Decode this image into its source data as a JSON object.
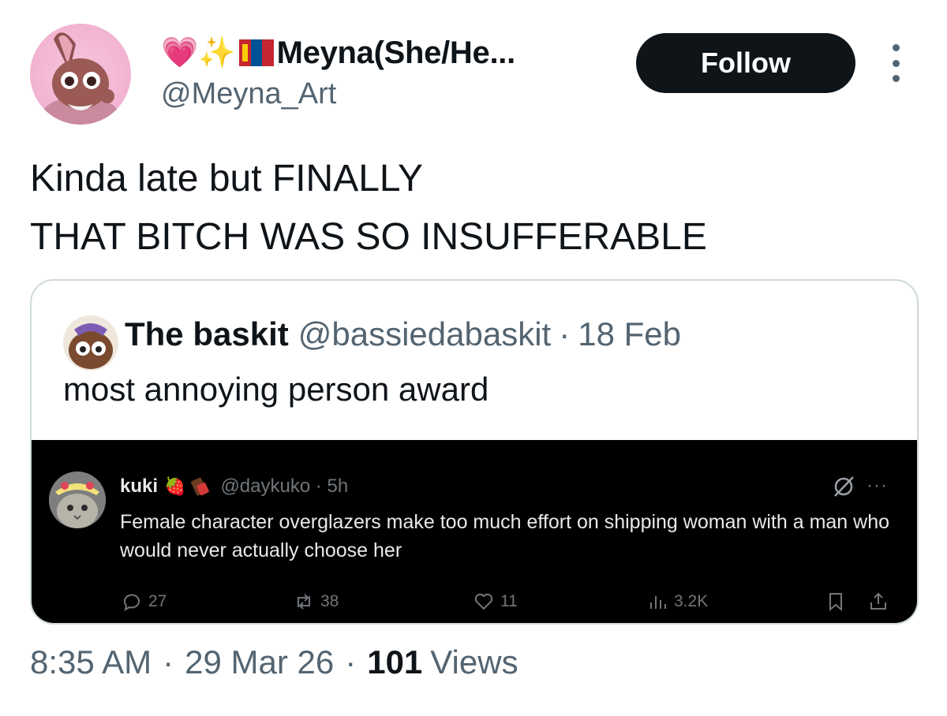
{
  "author": {
    "display_name_emoji": "💗✨",
    "display_name": "Meyna(She/He...",
    "handle": "@Meyna_Art"
  },
  "follow_label": "Follow",
  "tweet": {
    "line1": "Kinda late but FINALLY",
    "line2": "THAT BITCH WAS SO INSUFFERABLE"
  },
  "quote": {
    "name": "The baskit",
    "handle": "@bassiedabaskit",
    "dot": "·",
    "date": "18 Feb",
    "text": "most annoying person award"
  },
  "embedded": {
    "name": "kuki",
    "name_emoji": "🍓",
    "handle": "@daykuko · 5h",
    "text": "Female character overglazers make too much effort on shipping woman with a man who would never actually choose her",
    "more": "···",
    "replies": "27",
    "reposts": "38",
    "likes": "11",
    "views": "3.2K"
  },
  "footer": {
    "time": "8:35 AM",
    "sep1": "·",
    "date": "29 Mar 26",
    "sep2": "·",
    "views_count": "101",
    "views_label": "Views"
  },
  "colors": {
    "follow_bg": "#0f1419",
    "secondary_text": "#536471",
    "embed_bg": "#000000",
    "card_border": "#cfd9de"
  }
}
